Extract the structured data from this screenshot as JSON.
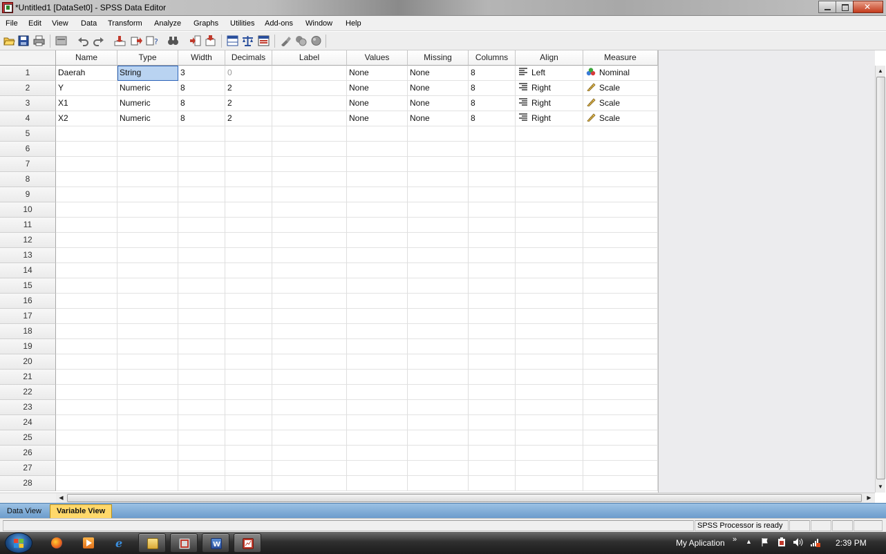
{
  "window": {
    "title": "*Untitled1 [DataSet0] - SPSS Data Editor"
  },
  "menu": [
    "File",
    "Edit",
    "View",
    "Data",
    "Transform",
    "Analyze",
    "Graphs",
    "Utilities",
    "Add-ons",
    "Window",
    "Help"
  ],
  "toolbar": {
    "icons": [
      "open-icon",
      "save-icon",
      "print-icon",
      "dialog-recall-icon",
      "undo-icon",
      "redo-icon",
      "goto-case-icon",
      "variables-icon",
      "find-icon",
      "insert-cases-icon",
      "insert-variable-icon",
      "split-file-icon",
      "weight-cases-icon",
      "select-cases-icon",
      "value-labels-icon",
      "use-sets-icon",
      "show-all-icon"
    ]
  },
  "grid": {
    "columns": [
      "Name",
      "Type",
      "Width",
      "Decimals",
      "Label",
      "Values",
      "Missing",
      "Columns",
      "Align",
      "Measure"
    ],
    "rows": [
      {
        "num": "1",
        "name": "Daerah",
        "type": "String",
        "width": "3",
        "decimals": "0",
        "label": "",
        "values": "None",
        "missing": "None",
        "columns": "8",
        "align": "Left",
        "measure": "Nominal"
      },
      {
        "num": "2",
        "name": "Y",
        "type": "Numeric",
        "width": "8",
        "decimals": "2",
        "label": "",
        "values": "None",
        "missing": "None",
        "columns": "8",
        "align": "Right",
        "measure": "Scale"
      },
      {
        "num": "3",
        "name": "X1",
        "type": "Numeric",
        "width": "8",
        "decimals": "2",
        "label": "",
        "values": "None",
        "missing": "None",
        "columns": "8",
        "align": "Right",
        "measure": "Scale"
      },
      {
        "num": "4",
        "name": "X2",
        "type": "Numeric",
        "width": "8",
        "decimals": "2",
        "label": "",
        "values": "None",
        "missing": "None",
        "columns": "8",
        "align": "Right",
        "measure": "Scale"
      }
    ],
    "empty_rows": [
      "5",
      "6",
      "7",
      "8",
      "9",
      "10",
      "11",
      "12",
      "13",
      "14",
      "15",
      "16",
      "17",
      "18",
      "19",
      "20",
      "21",
      "22",
      "23",
      "24",
      "25",
      "26",
      "27",
      "28"
    ],
    "selected_cell": {
      "row": 1,
      "column": "Type"
    }
  },
  "tabs": {
    "data_view": "Data View",
    "variable_view": "Variable View",
    "active": "variable_view"
  },
  "status": {
    "processor": "SPSS  Processor is ready"
  },
  "taskbar": {
    "toolbar_label": "My Aplication",
    "chevron": "»",
    "clock": "2:39 PM"
  },
  "colors": {
    "selection": "#b9d3f1",
    "active_tab": "#ffd86a",
    "tab_bar": "#7aa6d4"
  }
}
